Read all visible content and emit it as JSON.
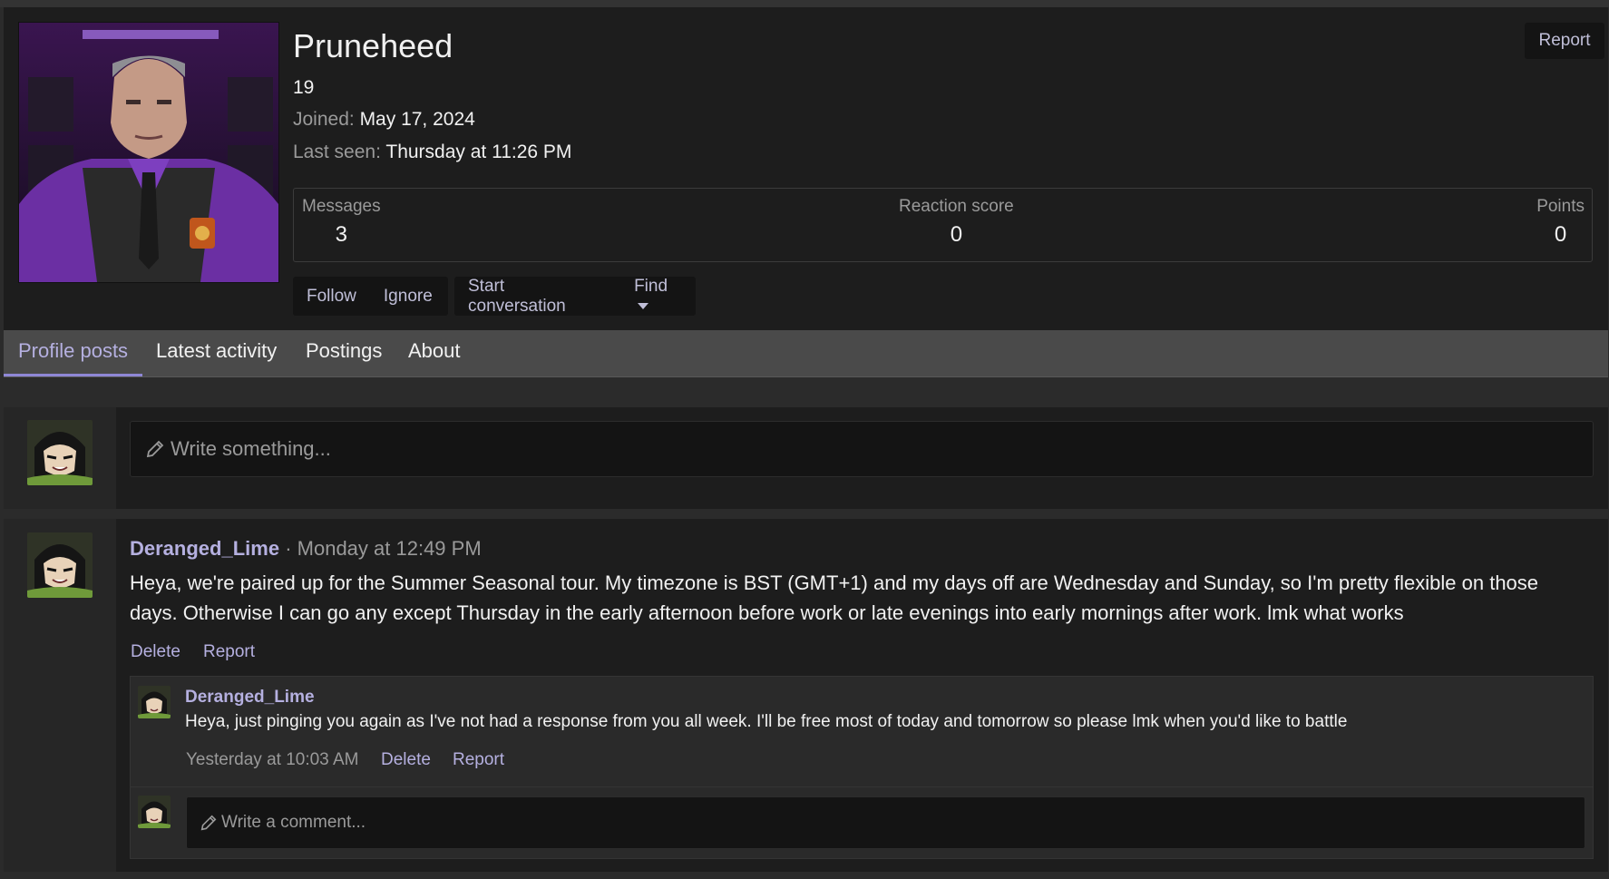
{
  "profile": {
    "username": "Pruneheed",
    "age": "19",
    "joined_label": "Joined:",
    "joined_value": "May 17, 2024",
    "last_seen_label": "Last seen:",
    "last_seen_value": "Thursday at 11:26 PM",
    "report_label": "Report",
    "stats": {
      "messages_label": "Messages",
      "messages_value": "3",
      "reaction_label": "Reaction score",
      "reaction_value": "0",
      "points_label": "Points",
      "points_value": "0"
    },
    "actions": {
      "follow": "Follow",
      "ignore": "Ignore",
      "start_conversation": "Start conversation",
      "find": "Find"
    }
  },
  "tabs": [
    {
      "label": "Profile posts",
      "active": true
    },
    {
      "label": "Latest activity",
      "active": false
    },
    {
      "label": "Postings",
      "active": false
    },
    {
      "label": "About",
      "active": false
    }
  ],
  "composer": {
    "placeholder": "Write something..."
  },
  "post": {
    "author": "Deranged_Lime",
    "separator": "·",
    "date": "Monday at 12:49 PM",
    "body": "Heya, we're paired up for the Summer Seasonal tour. My timezone is BST (GMT+1) and my days off are Wednesday and Sunday, so I'm pretty flexible on those days. Otherwise I can go any except Thursday in the early afternoon before work or late evenings into early mornings after work. lmk what works",
    "delete_label": "Delete",
    "report_label": "Report",
    "comment": {
      "author": "Deranged_Lime",
      "text": "Heya, just pinging you again as I've not had a response from you all week. I'll be free most of today and tomorrow so please lmk when you'd like to battle",
      "date": "Yesterday at 10:03 AM",
      "delete_label": "Delete",
      "report_label": "Report"
    },
    "reply_placeholder": "Write a comment..."
  },
  "colors": {
    "accent": "#b5b0e0",
    "tab_underline": "#8f87d6",
    "panel_bg": "#1d1d1d",
    "page_bg": "#2b2b2b"
  }
}
